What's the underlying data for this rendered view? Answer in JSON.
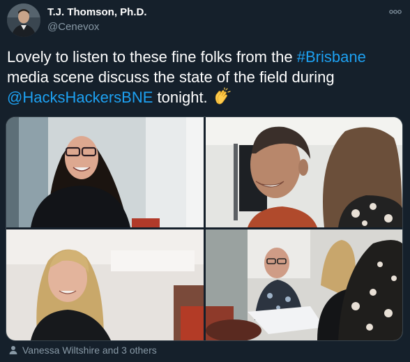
{
  "author": {
    "name": "T.J. Thomson, Ph.D.",
    "handle": "@Cenevox"
  },
  "tweet": {
    "text_part1": "Lovely to listen to these fine folks from the ",
    "hashtag": "#Brisbane",
    "text_part2": " media scene discuss the state of the field during ",
    "mention": "@HacksHackersBNE",
    "text_part3": " tonight. ",
    "emoji_icon": "clapping-hands-icon"
  },
  "media": {
    "photo_count": 4
  },
  "tagged": {
    "label": "Vanessa Wiltshire and 3 others"
  },
  "colors": {
    "background": "#15202b",
    "text": "#ffffff",
    "secondary": "#8899a6",
    "link": "#1da1f2",
    "border": "#38444d"
  },
  "icons": [
    "more-options-icon",
    "clapping-hands-icon",
    "person-icon"
  ]
}
